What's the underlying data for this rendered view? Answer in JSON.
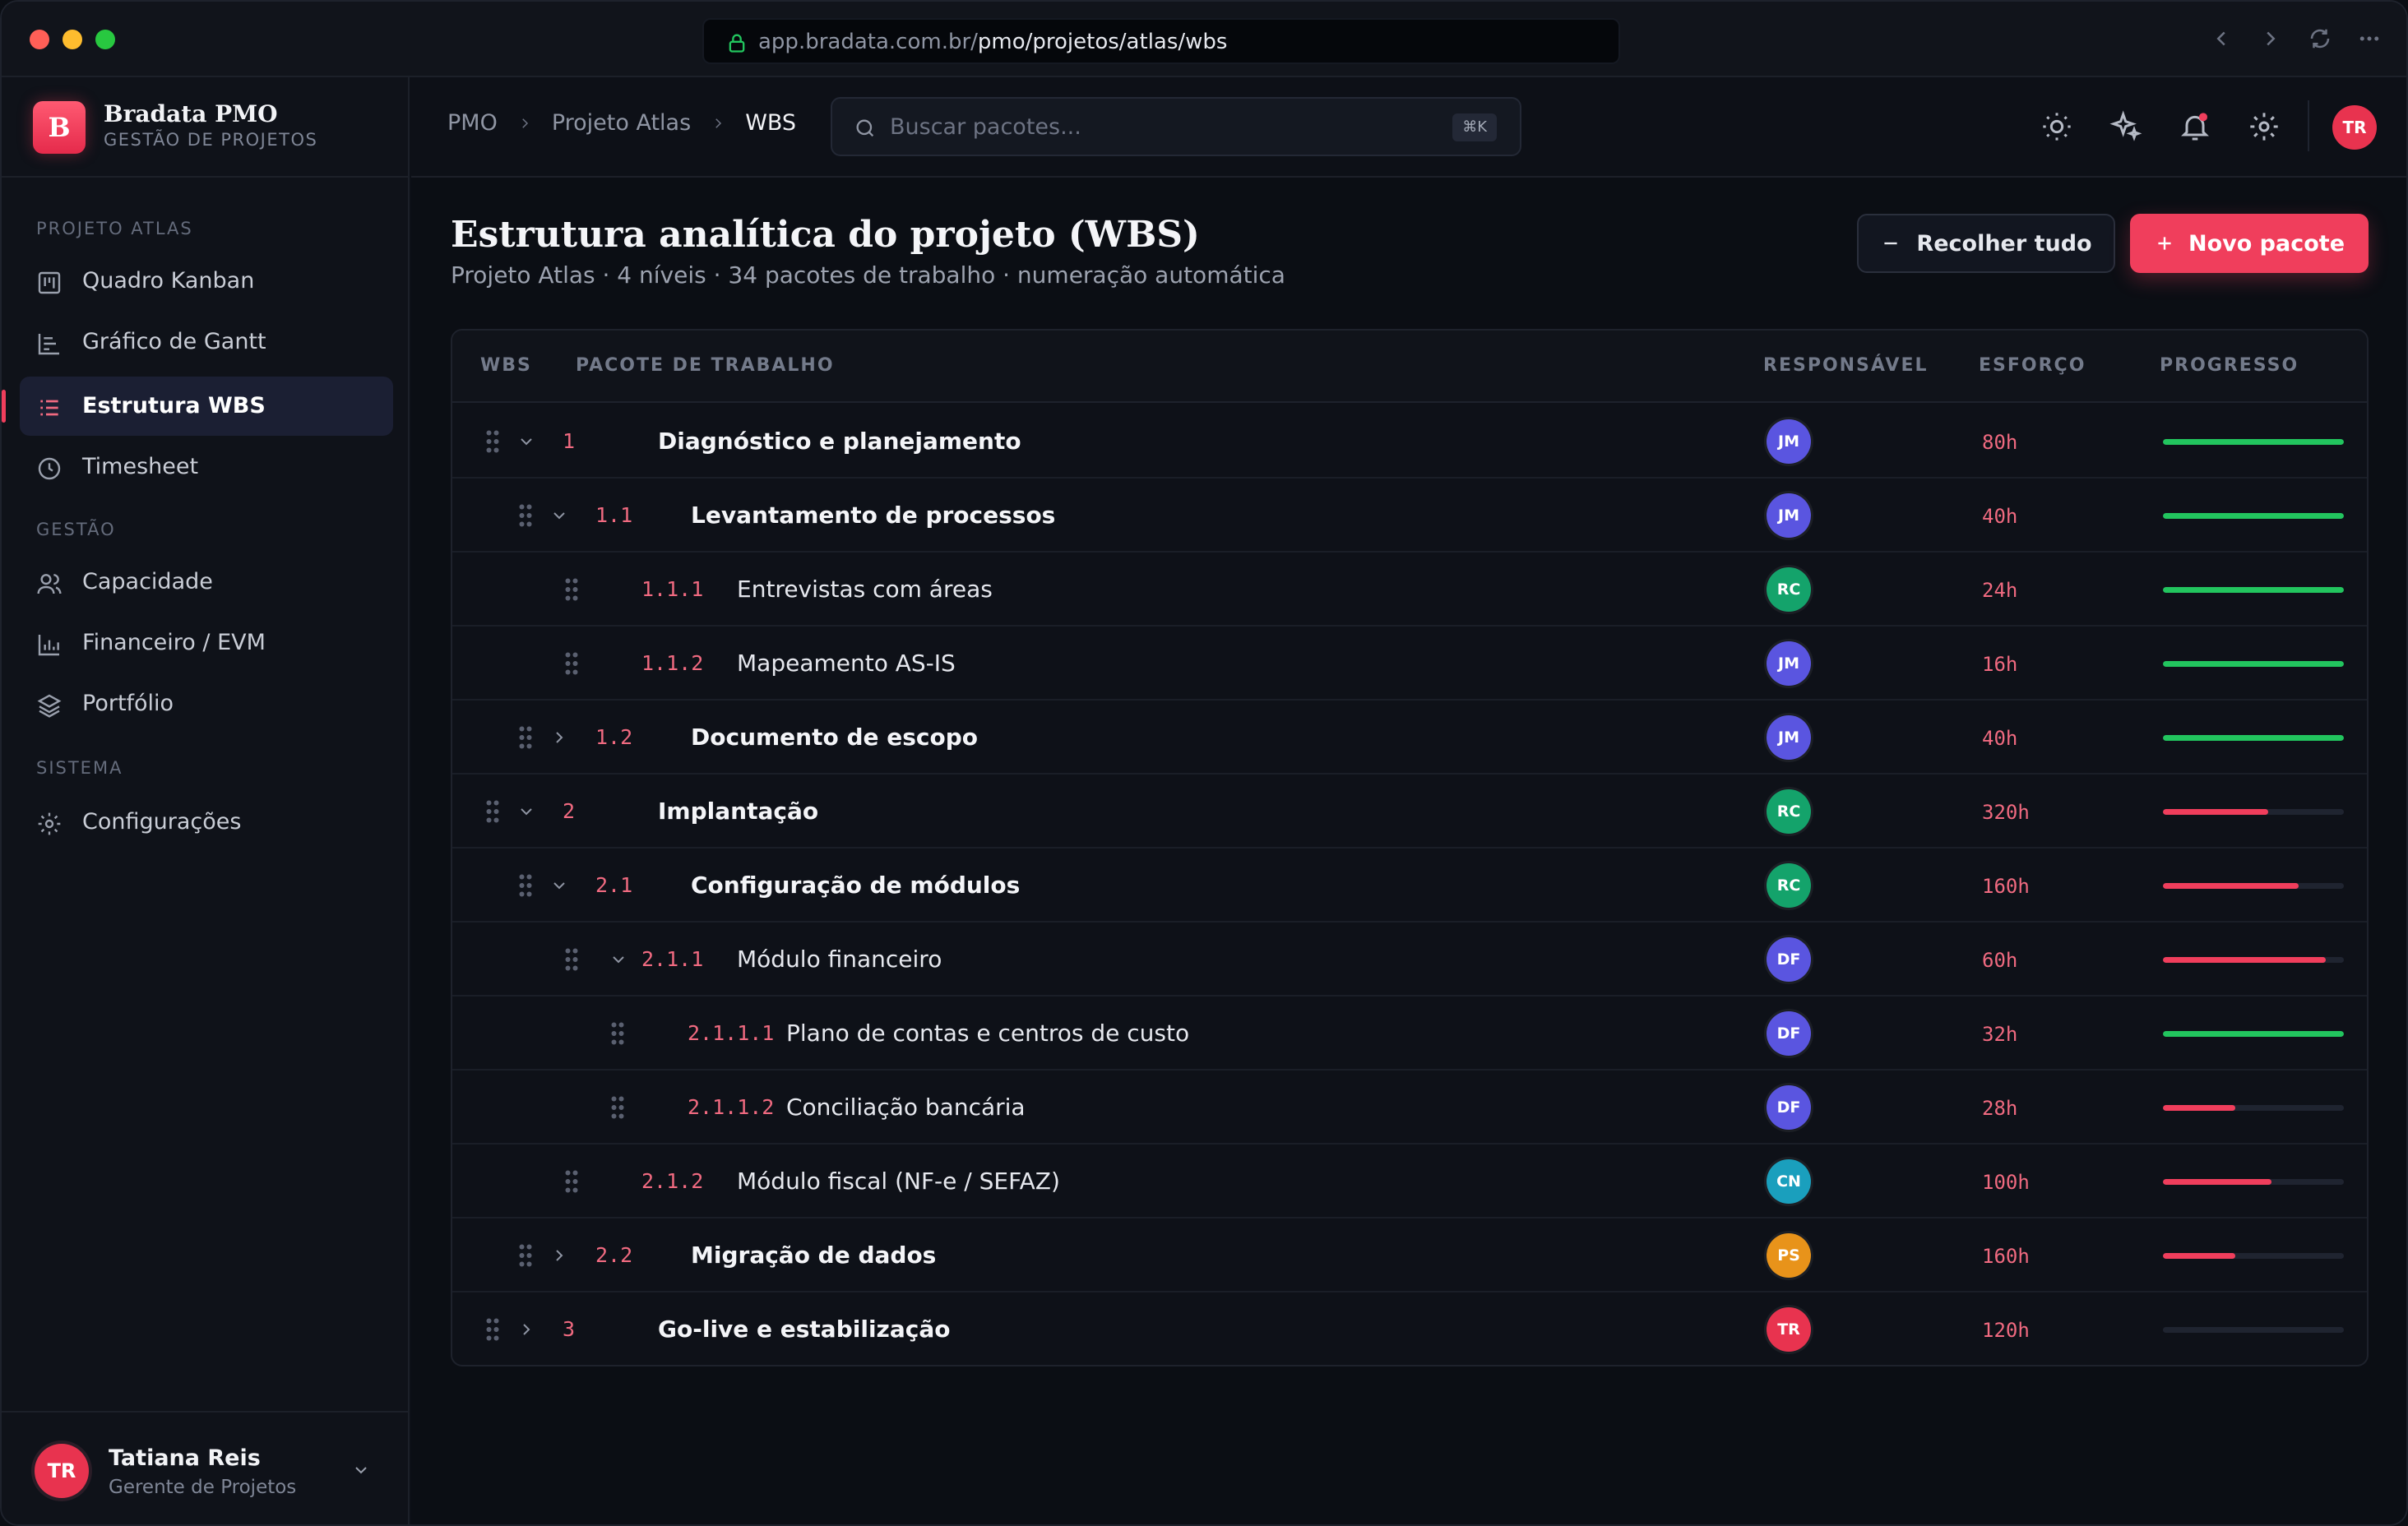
{
  "browser": {
    "url_host": "app.bradata.com.br/",
    "url_path": "pmo/projetos/atlas/wbs"
  },
  "brand": {
    "logo_letter": "B",
    "name": "Bradata PMO",
    "subtitle": "GESTÃO DE PROJETOS"
  },
  "sidebar": {
    "sections": [
      {
        "label": "PROJETO ATLAS",
        "items": [
          {
            "label": "Quadro Kanban",
            "icon": "kanban-icon"
          },
          {
            "label": "Gráfico de Gantt",
            "icon": "gantt-icon"
          },
          {
            "label": "Estrutura WBS",
            "icon": "list-tree-icon",
            "active": true
          },
          {
            "label": "Timesheet",
            "icon": "clock-icon"
          }
        ]
      },
      {
        "label": "GESTÃO",
        "items": [
          {
            "label": "Capacidade",
            "icon": "users-icon"
          },
          {
            "label": "Financeiro / EVM",
            "icon": "bar-chart-icon"
          },
          {
            "label": "Portfólio",
            "icon": "layers-icon"
          }
        ]
      },
      {
        "label": "SISTEMA",
        "items": [
          {
            "label": "Configurações",
            "icon": "gear-icon"
          }
        ]
      }
    ]
  },
  "user": {
    "initials": "TR",
    "name": "Tatiana Reis",
    "role": "Gerente de Projetos"
  },
  "breadcrumb": [
    "PMO",
    "Projeto Atlas",
    "WBS"
  ],
  "search": {
    "placeholder": "Buscar pacotes...",
    "shortcut": "⌘K"
  },
  "top_avatar": "TR",
  "page": {
    "title": "Estrutura analítica do projeto (WBS)",
    "subtitle": "Projeto Atlas · 4 níveis · 34 pacotes de trabalho · numeração automática",
    "collapse_label": "Recolher tudo",
    "new_label": "Novo pacote"
  },
  "table": {
    "headers": {
      "wbs": "WBS",
      "package": "PACOTE DE TRABALHO",
      "owner": "RESPONSÁVEL",
      "effort": "ESFORÇO",
      "progress": "PROGRESSO"
    },
    "rows": [
      {
        "level": 0,
        "code": "1",
        "name": "Diagnóstico e planejamento",
        "caret": "down",
        "owner": "JM",
        "effort": "80h",
        "progress": 1.0
      },
      {
        "level": 1,
        "code": "1.1",
        "name": "Levantamento de processos",
        "caret": "down",
        "owner": "JM",
        "effort": "40h",
        "progress": 1.0
      },
      {
        "level": 2,
        "code": "1.1.1",
        "name": "Entrevistas com áreas",
        "caret": "none",
        "owner": "RC",
        "effort": "24h",
        "progress": 1.0
      },
      {
        "level": 2,
        "code": "1.1.2",
        "name": "Mapeamento AS-IS",
        "caret": "none",
        "owner": "JM",
        "effort": "16h",
        "progress": 1.0
      },
      {
        "level": 1,
        "code": "1.2",
        "name": "Documento de escopo",
        "caret": "right",
        "owner": "JM",
        "effort": "40h",
        "progress": 1.0
      },
      {
        "level": 0,
        "code": "2",
        "name": "Implantação",
        "caret": "down",
        "owner": "RC",
        "effort": "320h",
        "progress": 0.58
      },
      {
        "level": 1,
        "code": "2.1",
        "name": "Configuração de módulos",
        "caret": "down",
        "owner": "RC",
        "effort": "160h",
        "progress": 0.75
      },
      {
        "level": 2,
        "code": "2.1.1",
        "name": "Módulo financeiro",
        "caret": "down",
        "owner": "DF",
        "effort": "60h",
        "progress": 0.9
      },
      {
        "level": 3,
        "code": "2.1.1.1",
        "name": "Plano de contas e centros de custo",
        "caret": "none",
        "owner": "DF",
        "effort": "32h",
        "progress": 1.0
      },
      {
        "level": 3,
        "code": "2.1.1.2",
        "name": "Conciliação bancária",
        "caret": "none",
        "owner": "DF",
        "effort": "28h",
        "progress": 0.4
      },
      {
        "level": 2,
        "code": "2.1.2",
        "name": "Módulo fiscal (NF-e / SEFAZ)",
        "caret": "none",
        "owner": "CN",
        "effort": "100h",
        "progress": 0.6
      },
      {
        "level": 1,
        "code": "2.2",
        "name": "Migração de dados",
        "caret": "right",
        "owner": "PS",
        "effort": "160h",
        "progress": 0.4
      },
      {
        "level": 0,
        "code": "3",
        "name": "Go-live e estabilização",
        "caret": "right",
        "owner": "TR",
        "effort": "120h",
        "progress": 0.0
      }
    ]
  },
  "colors": {
    "accent": "#f03e5c",
    "progress_complete": "#22c55e",
    "progress_partial": "#f03e5c",
    "avatar_JM": "#5a55e0",
    "avatar_RC": "#14a36b",
    "avatar_DF": "#5a55e0",
    "avatar_CN": "#1a9fbd",
    "avatar_PS": "#e8931a",
    "avatar_TR": "#e8334f"
  }
}
